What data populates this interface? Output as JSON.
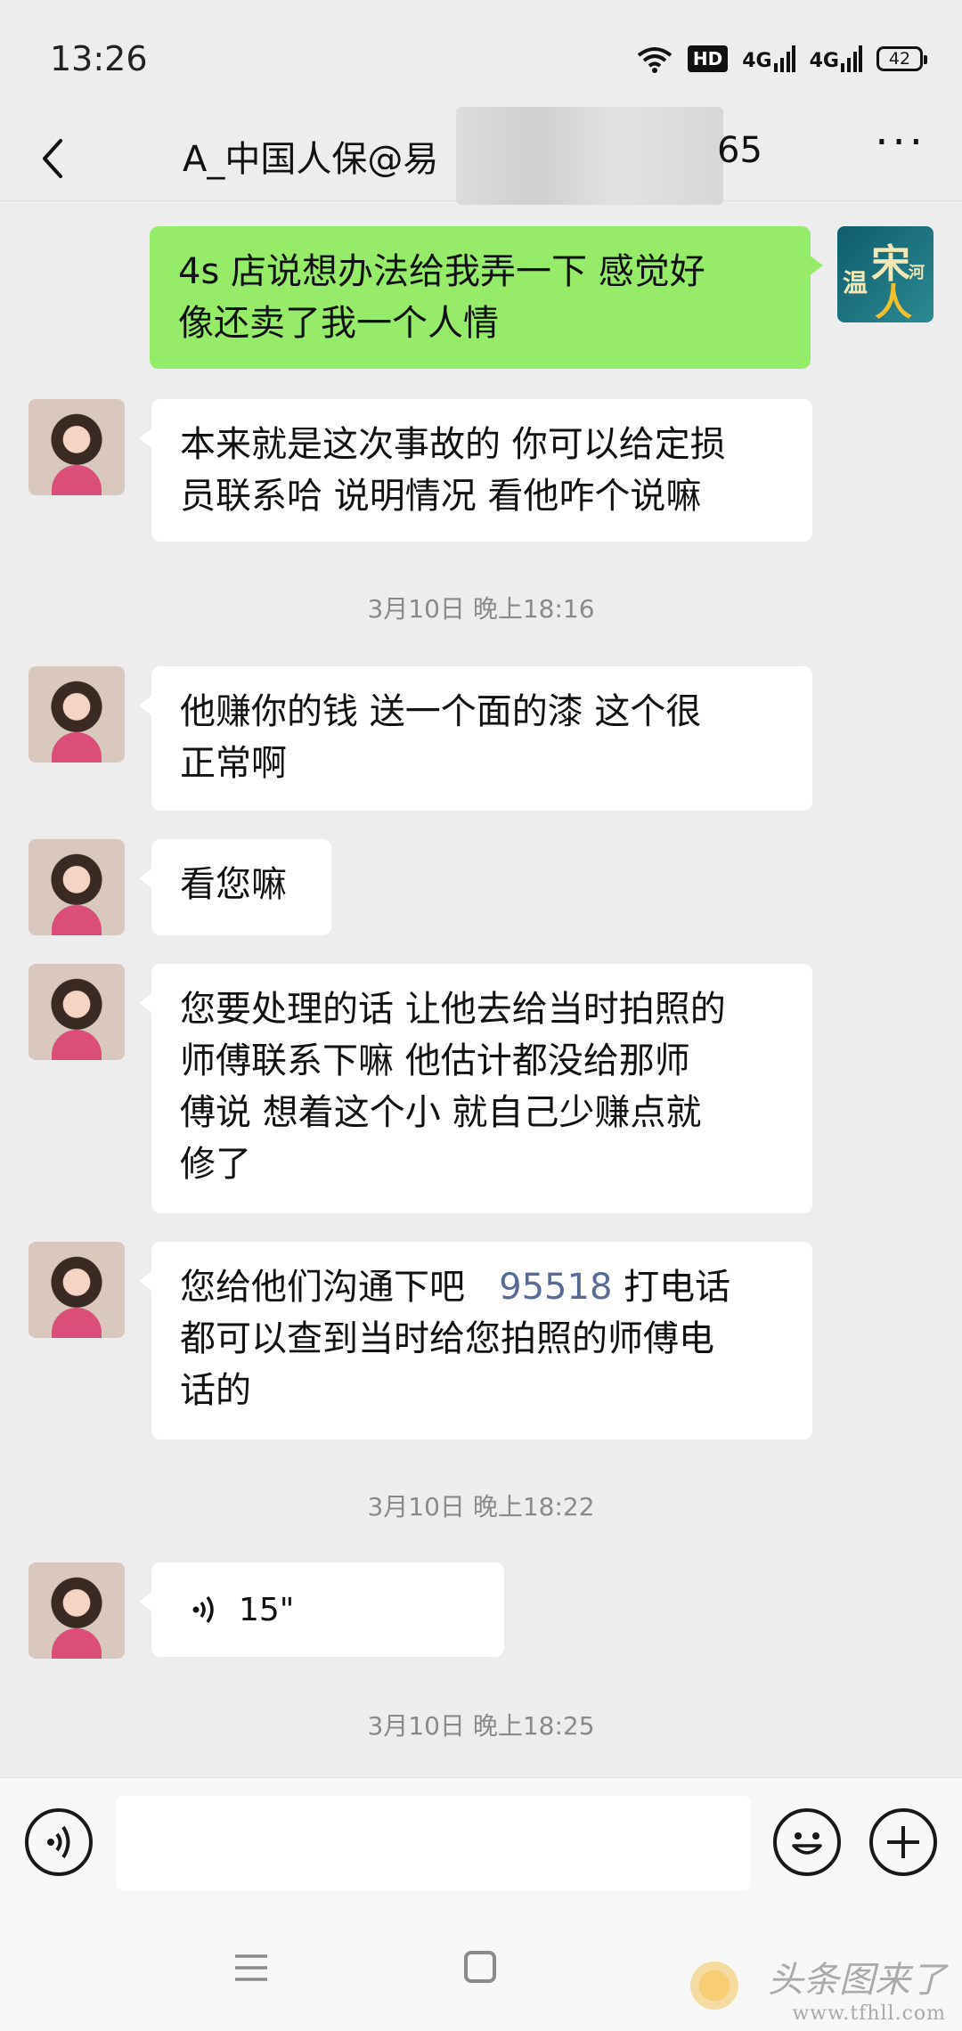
{
  "status_bar": {
    "time": "13:26",
    "hd_label": "HD",
    "net1": "4G",
    "net2": "4G",
    "battery": "42"
  },
  "header": {
    "title_prefix": "A_中国人保@易",
    "title_suffix": "65",
    "more": "···"
  },
  "messages": [
    {
      "side": "me",
      "text": "4s 店说想办法给我弄一下 感觉好像还卖了我一个人情",
      "line1": "4s 店说想办法给我弄一下 感觉好",
      "line2": "像还卖了我一个人情"
    },
    {
      "side": "other",
      "line1": "本来就是这次事故的 你可以给定损",
      "line2": "员联系哈 说明情况 看他咋个说嘛"
    },
    {
      "side": "other",
      "line1": "他赚你的钱 送一个面的漆 这个很",
      "line2": "正常啊"
    },
    {
      "side": "other",
      "line1": "看您嘛"
    },
    {
      "side": "other",
      "line1": "您要处理的话 让他去给当时拍照的",
      "line2": "师傅联系下嘛  他估计都没给那师",
      "line3": "傅说 想着这个小  就自己少赚点就",
      "line4": "修了"
    },
    {
      "side": "other",
      "line1_pre": "您给他们沟通下吧   ",
      "phone": "95518",
      "line1_post": " 打电话",
      "line2": "都可以查到当时给您拍照的师傅电",
      "line3": "话的"
    },
    {
      "side": "other",
      "voice_duration": "15\""
    }
  ],
  "timestamps": [
    "3月10日 晚上18:16",
    "3月10日 晚上18:22",
    "3月10日 晚上18:25"
  ],
  "my_avatar_chars": {
    "a": "宋",
    "b": "温",
    "c": "人",
    "d": "河"
  },
  "input": {
    "placeholder": ""
  },
  "watermark": {
    "line1": "头条图来了",
    "line2": "www.tfhll.com"
  },
  "colors": {
    "my_bubble": "#95ec69",
    "other_bubble": "#ffffff",
    "background": "#ededed",
    "link": "#576b95"
  }
}
